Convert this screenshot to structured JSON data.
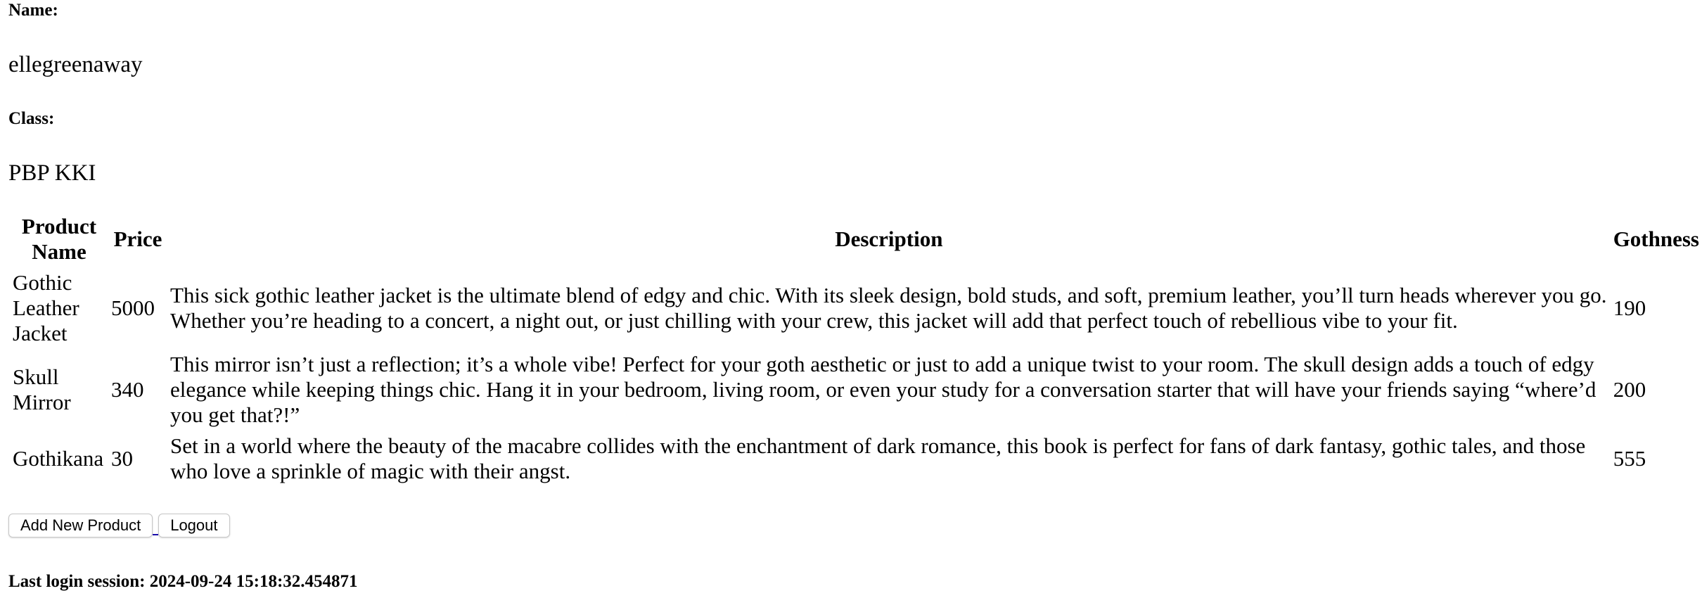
{
  "profile": {
    "name_label": "Name:",
    "name_value": "ellegreenaway",
    "class_label": "Class:",
    "class_value": "PBP KKI"
  },
  "table": {
    "headers": {
      "name": "Product Name",
      "price": "Price",
      "description": "Description",
      "gothness": "Gothness"
    },
    "rows": [
      {
        "name": "Gothic Leather Jacket",
        "price": "5000",
        "description": "This sick gothic leather jacket is the ultimate blend of edgy and chic. With its sleek design, bold studs, and soft, premium leather, you’ll turn heads wherever you go. Whether you’re heading to a concert, a night out, or just chilling with your crew, this jacket will add that perfect touch of rebellious vibe to your fit.",
        "gothness": "190"
      },
      {
        "name": "Skull Mirror",
        "price": "340",
        "description": "This mirror isn’t just a reflection; it’s a whole vibe! Perfect for your goth aesthetic or just to add a unique twist to your room. The skull design adds a touch of edgy elegance while keeping things chic. Hang it in your bedroom, living room, or even your study for a conversation starter that will have your friends saying “where’d you get that?!”",
        "gothness": "200"
      },
      {
        "name": "Gothikana",
        "price": "30",
        "description": "Set in a world where the beauty of the macabre collides with the enchantment of dark romance, this book is perfect for fans of dark fantasy, gothic tales, and those who love a sprinkle of magic with their angst.",
        "gothness": "555"
      }
    ]
  },
  "actions": {
    "add_product_label": "Add New Product",
    "logout_label": "Logout"
  },
  "session": {
    "last_login": "Last login session: 2024-09-24 15:18:32.454871"
  }
}
